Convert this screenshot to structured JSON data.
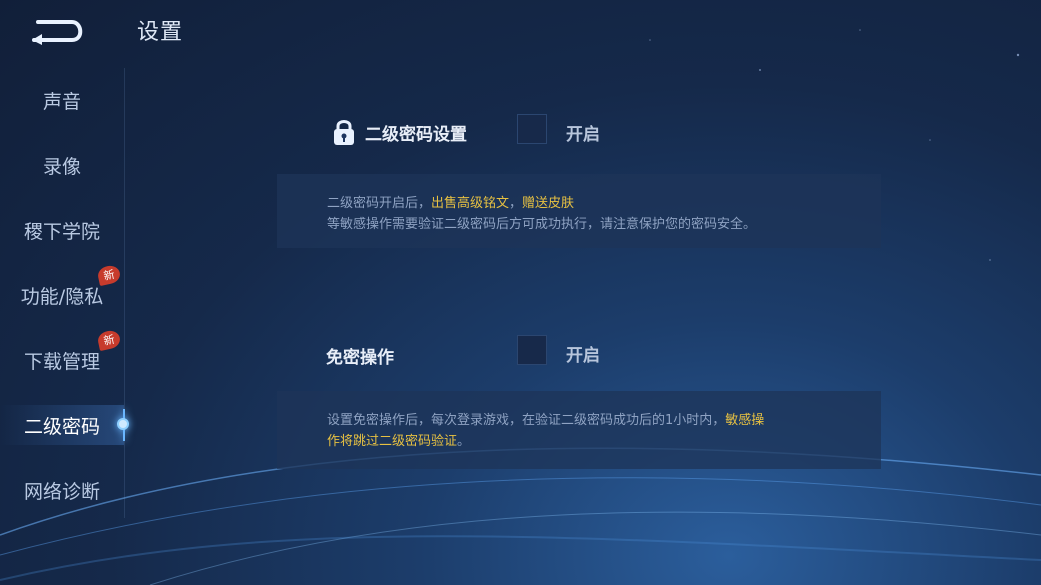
{
  "header": {
    "title": "设置"
  },
  "sidebar": {
    "items": [
      {
        "label": "声音"
      },
      {
        "label": "录像"
      },
      {
        "label": "稷下学院"
      },
      {
        "label": "功能/隐私",
        "badge": "新"
      },
      {
        "label": "下载管理",
        "badge": "新"
      },
      {
        "label": "二级密码",
        "active": true
      },
      {
        "label": "网络诊断"
      }
    ]
  },
  "settings": {
    "secondary_password": {
      "label": "二级密码设置",
      "toggle_label": "开启",
      "desc_prefix": "二级密码开启后，",
      "desc_highlight_1": "出售高级铭文",
      "desc_sep": "，",
      "desc_highlight_2": "赠送皮肤",
      "desc_line2": "等敏感操作需要验证二级密码后方可成功执行，请注意保护您的密码安全。"
    },
    "password_free": {
      "label": "免密操作",
      "toggle_label": "开启",
      "desc_plain": "设置免密操作后，每次登录游戏，在验证二级密码成功后的1小时内，",
      "desc_highlight_a": "敏感操",
      "desc_highlight_b": "作将跳过二级密码验证",
      "desc_end": "。"
    }
  },
  "colors": {
    "highlight": "#e7c142",
    "accent": "#6bb7ff"
  }
}
